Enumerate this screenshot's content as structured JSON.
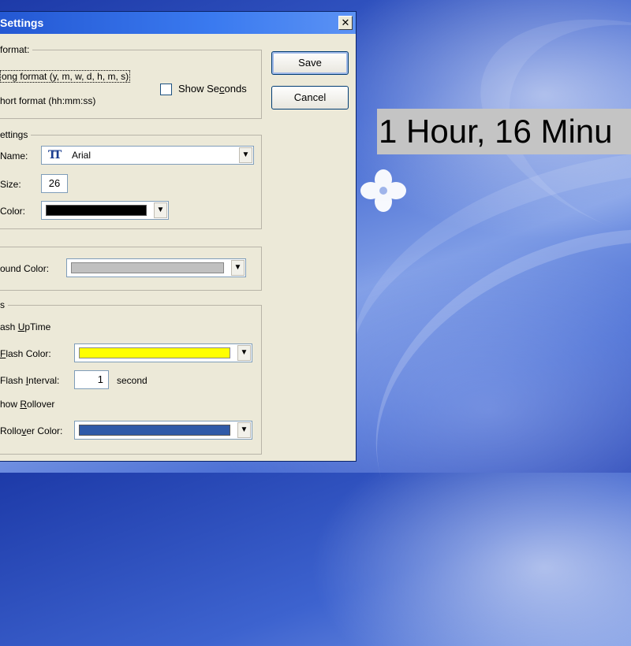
{
  "overlay": {
    "timer_text": "1 Hour, 16 Minu"
  },
  "dialog": {
    "title": "Settings",
    "close_glyph": "✕",
    "buttons": {
      "save": "Save",
      "cancel": "Cancel"
    },
    "format_group": {
      "title": "format:",
      "long_format": "ong format (y, m, w, d, h, m, s)",
      "short_format": "hort format (hh:mm:ss)",
      "show_seconds": "Show Seconds",
      "show_seconds_checked": false
    },
    "font_group": {
      "title": "ettings",
      "name_label": "Name:",
      "name_value": "Arial",
      "font_icon": "truetype-font-icon",
      "size_label": "Size:",
      "size_value": "26",
      "color_label": "Color:",
      "color_value": "#000000"
    },
    "background_group": {
      "label": "ound Color:",
      "color_value": "#c0c0c0"
    },
    "options_group": {
      "title": "s",
      "flash_uptime": "ash UpTime",
      "flash_color_label": "Flash Color:",
      "flash_color_value": "#ffff00",
      "flash_interval_label": "Flash Interval:",
      "flash_interval_value": "1",
      "flash_interval_unit": "second",
      "show_rollover": "how Rollover",
      "rollover_color_label": "Rollover Color:",
      "rollover_color_value": "#2f5aa8"
    },
    "dropdown_glyph": "▼"
  }
}
